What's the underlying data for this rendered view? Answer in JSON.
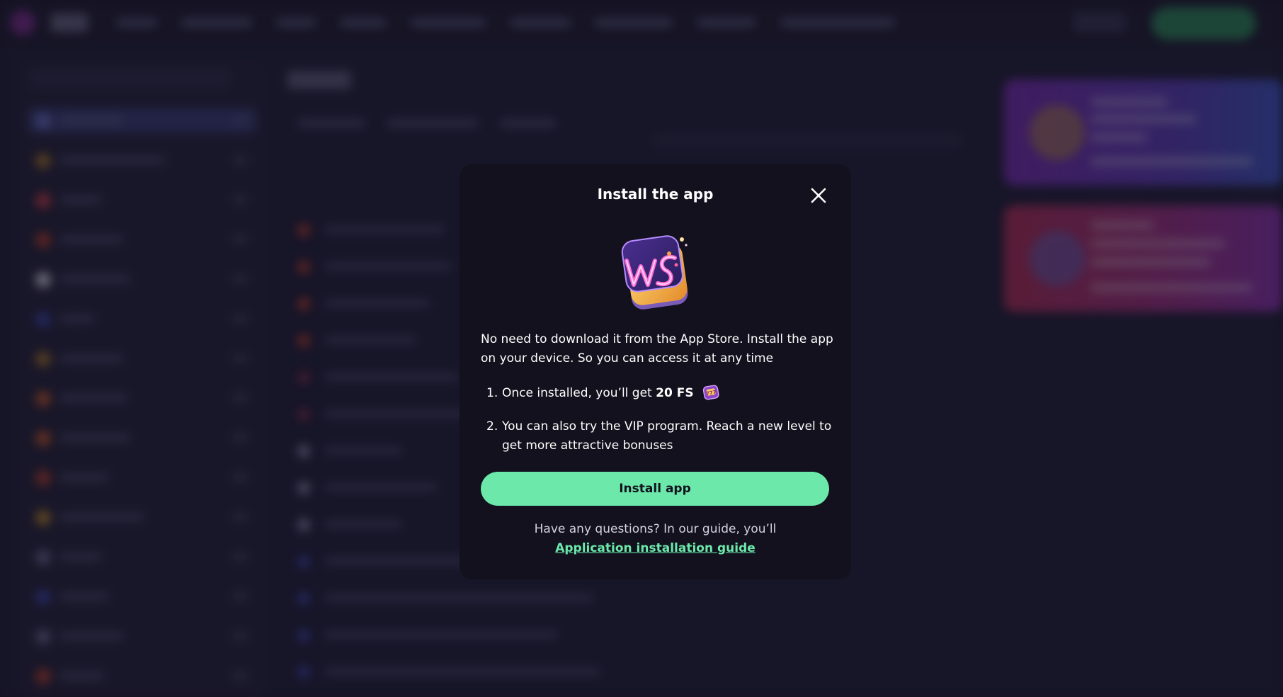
{
  "modal": {
    "title": "Install the app",
    "description": "No need to download it from the App Store. Install the app on your device. So you can access it at any time",
    "steps": [
      {
        "number": "1.",
        "text_before": "Once installed, you’ll get ",
        "bold": "20 FS",
        "icon": "gem-slot-icon"
      },
      {
        "number": "2.",
        "text": "You can also try the VIP program. Reach a new level to get more attractive bonuses"
      }
    ],
    "install_button_label": "Install app",
    "faq_text": "Have any questions? In our guide, you’ll",
    "guide_link_label": "Application installation guide",
    "close_icon": "close-icon",
    "app_icon": "ws-app-icon"
  },
  "colors": {
    "modal_bg": "#12111d",
    "accent": "#6ce8ab",
    "page_bg": "#1d1b2c"
  }
}
